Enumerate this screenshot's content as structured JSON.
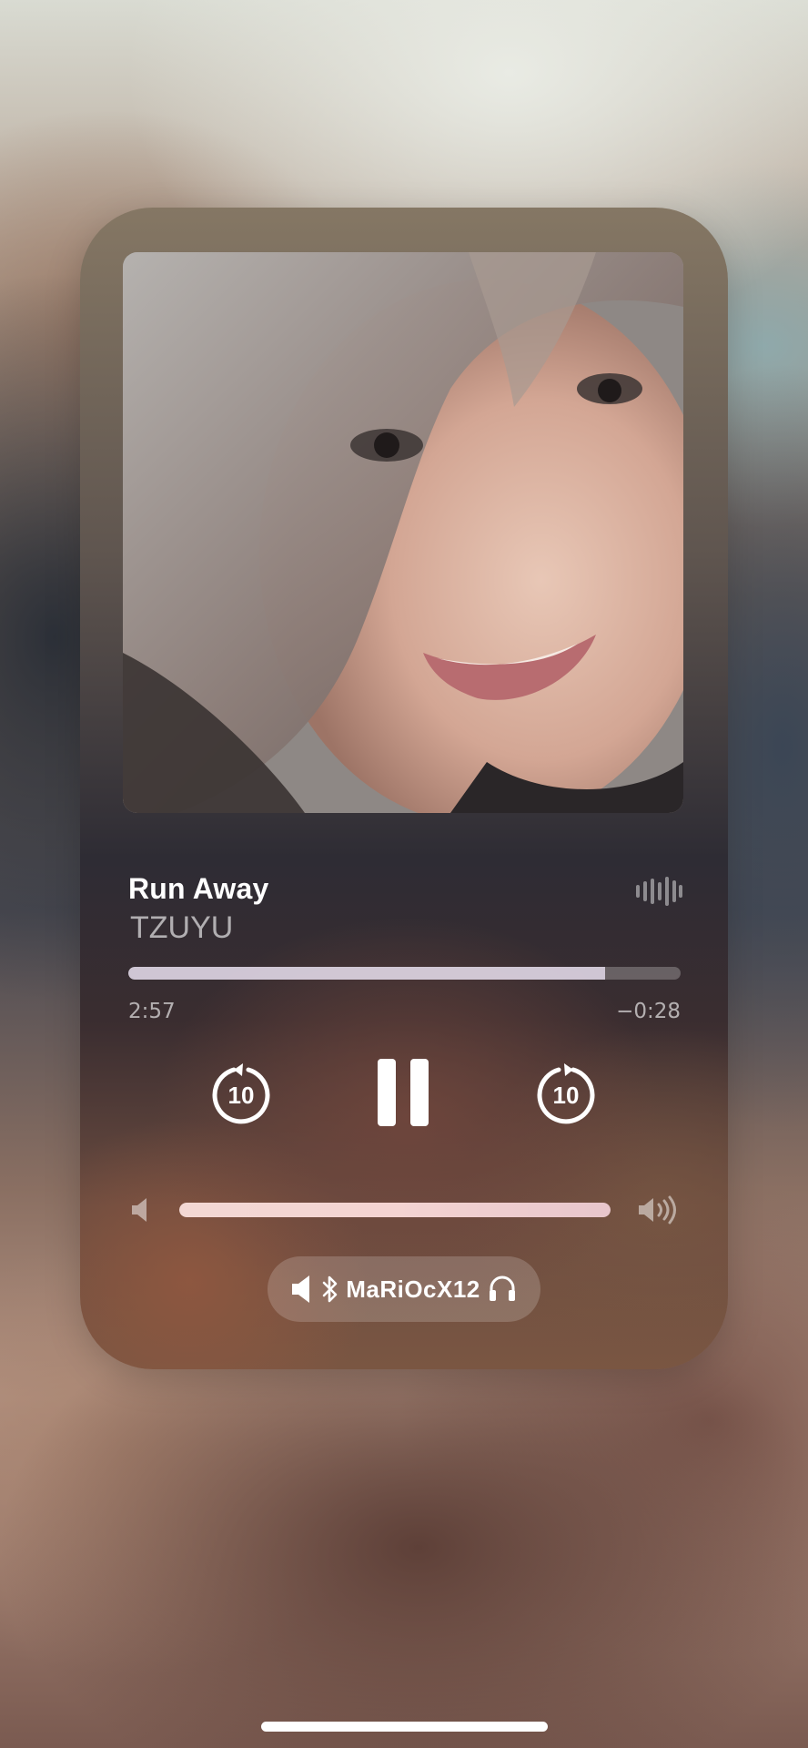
{
  "now_playing": {
    "title": "Run Away",
    "artist": "TZUYU",
    "artwork_icon": "album-artwork",
    "audio_quality_icon": "waveform-icon"
  },
  "progress": {
    "elapsed": "2:57",
    "remaining": "−0:28",
    "fraction": 0.864
  },
  "controls": {
    "skip_back_seconds": "10",
    "skip_forward_seconds": "10",
    "play_state": "playing",
    "pause_icon": "pause-icon"
  },
  "volume": {
    "level": 1.0,
    "low_icon": "speaker-low-icon",
    "high_icon": "speaker-high-icon"
  },
  "output_route": {
    "name": "MaRiOcX12",
    "icons": [
      "speaker-icon",
      "bluetooth-icon",
      "headphones-icon"
    ]
  },
  "colors": {
    "text_primary": "#ffffff",
    "text_secondary": "rgba(255,255,255,0.62)",
    "progress_fill": "#e2d8e8",
    "volume_fill": "#f4d4d2"
  }
}
